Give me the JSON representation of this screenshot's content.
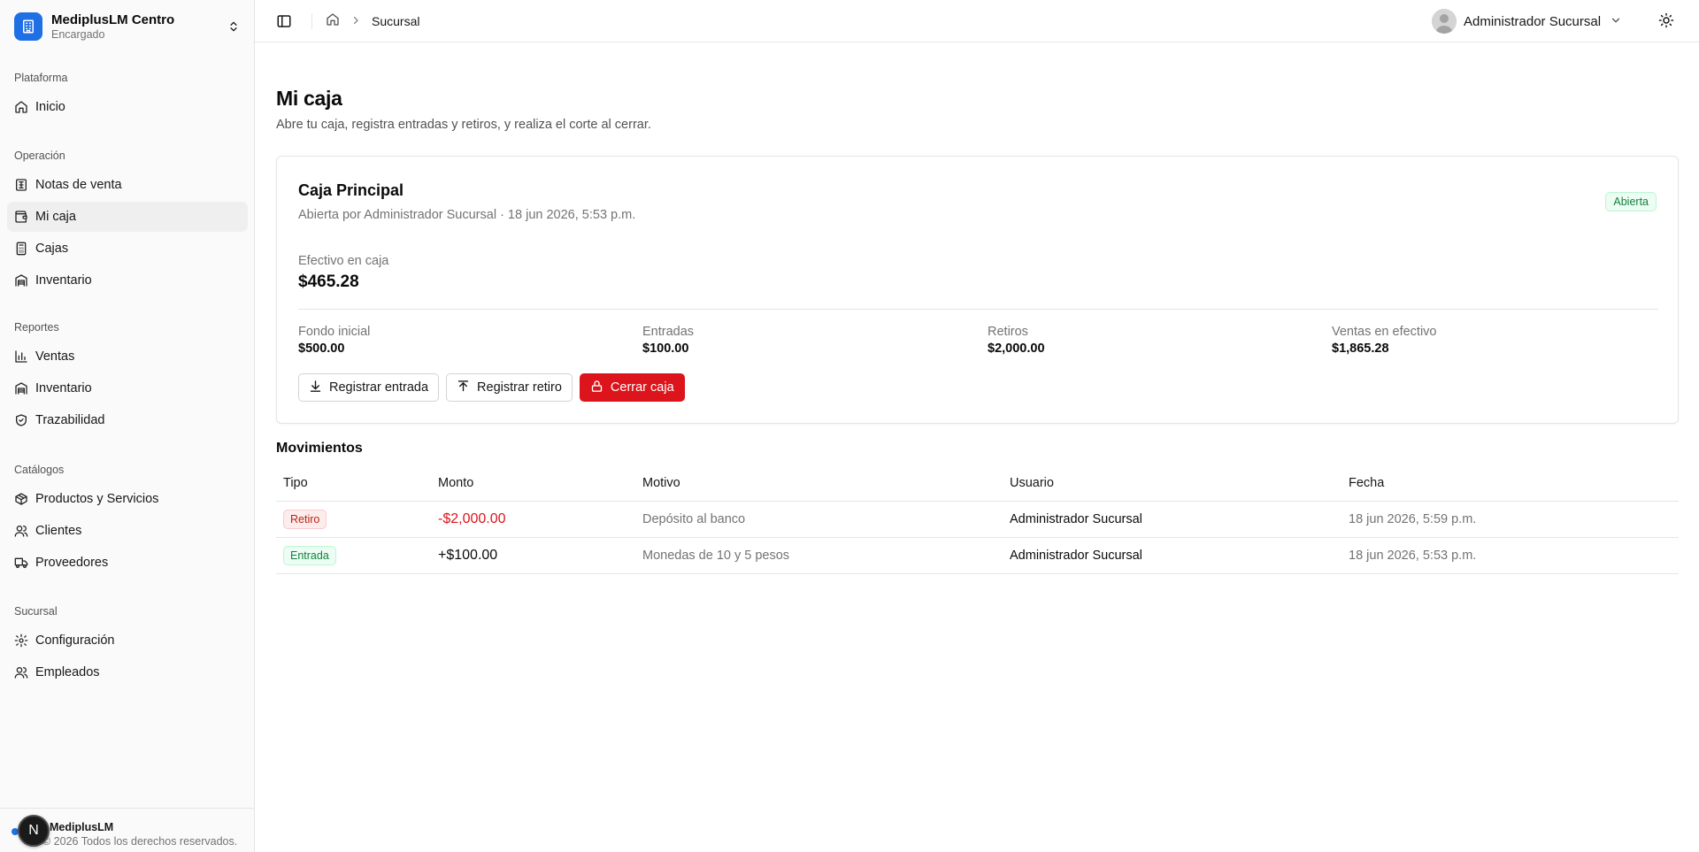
{
  "sidebar": {
    "brand": {
      "name": "MediplusLM Centro",
      "role": "Encargado"
    },
    "groups": [
      {
        "label": "Plataforma",
        "items": [
          {
            "label": "Inicio",
            "icon": "home-icon"
          }
        ]
      },
      {
        "label": "Operación",
        "items": [
          {
            "label": "Notas de venta",
            "icon": "receipt-icon"
          },
          {
            "label": "Mi caja",
            "icon": "wallet-icon",
            "active": true
          },
          {
            "label": "Cajas",
            "icon": "calculator-icon"
          },
          {
            "label": "Inventario",
            "icon": "warehouse-icon"
          }
        ]
      },
      {
        "label": "Reportes",
        "items": [
          {
            "label": "Ventas",
            "icon": "bar-chart-icon"
          },
          {
            "label": "Inventario",
            "icon": "warehouse-icon"
          },
          {
            "label": "Trazabilidad",
            "icon": "shield-check-icon"
          }
        ]
      },
      {
        "label": "Catálogos",
        "items": [
          {
            "label": "Productos y Servicios",
            "icon": "package-icon"
          },
          {
            "label": "Clientes",
            "icon": "users-icon"
          },
          {
            "label": "Proveedores",
            "icon": "truck-icon"
          }
        ]
      },
      {
        "label": "Sucursal",
        "items": [
          {
            "label": "Configuración",
            "icon": "gear-icon"
          },
          {
            "label": "Empleados",
            "icon": "users-icon"
          }
        ]
      }
    ],
    "footer": {
      "badge": "N",
      "name": "MediplusLM",
      "copyright": "© 2026 Todos los derechos reservados."
    }
  },
  "header": {
    "breadcrumb": "Sucursal",
    "user_name": "Administrador Sucursal"
  },
  "page": {
    "title": "Mi caja",
    "subtitle": "Abre tu caja, registra entradas y retiros, y realiza el corte al cerrar."
  },
  "register": {
    "title": "Caja Principal",
    "meta": "Abierta por Administrador Sucursal · 18 jun 2026, 5:53 p.m.",
    "status": "Abierta",
    "cash_label": "Efectivo en caja",
    "cash_value": "$465.28",
    "stats": [
      {
        "label": "Fondo inicial",
        "value": "$500.00"
      },
      {
        "label": "Entradas",
        "value": "$100.00"
      },
      {
        "label": "Retiros",
        "value": "$2,000.00"
      },
      {
        "label": "Ventas en efectivo",
        "value": "$1,865.28"
      }
    ],
    "actions": {
      "entry": "Registrar entrada",
      "withdraw": "Registrar retiro",
      "close": "Cerrar caja"
    }
  },
  "movements": {
    "title": "Movimientos",
    "columns": [
      "Tipo",
      "Monto",
      "Motivo",
      "Usuario",
      "Fecha"
    ],
    "rows": [
      {
        "type": "Retiro",
        "amount": "-$2,000.00",
        "reason": "Depósito al banco",
        "user": "Administrador Sucursal",
        "date": "18 jun 2026, 5:59 p.m."
      },
      {
        "type": "Entrada",
        "amount": "+$100.00",
        "reason": "Monedas de 10 y 5 pesos",
        "user": "Administrador Sucursal",
        "date": "18 jun 2026, 5:53 p.m."
      }
    ]
  },
  "colors": {
    "brand": "#1f6fe5",
    "danger": "#dc141b",
    "success": "#15803d"
  }
}
